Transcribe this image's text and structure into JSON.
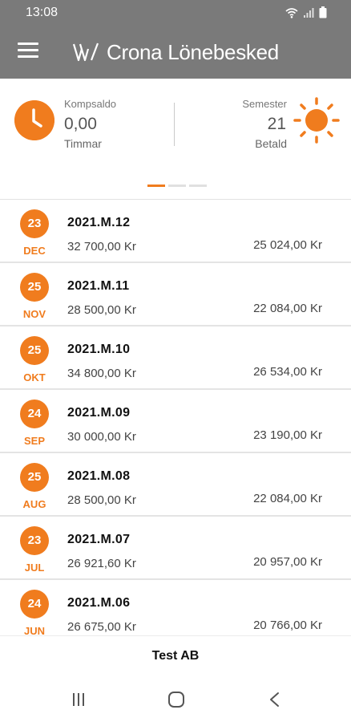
{
  "status_bar": {
    "time": "13:08",
    "icons": [
      "wifi-icon",
      "signal-icon",
      "battery-icon"
    ]
  },
  "app_bar": {
    "title": "Crona Lönebesked",
    "menu_icon": "hamburger-menu-icon",
    "logo_icon": "crona-logo-icon"
  },
  "colors": {
    "accent": "#f07c1e",
    "app_bar": "#7a7a7a"
  },
  "summary": {
    "komp": {
      "label": "Kompsaldo",
      "value": "0,00",
      "unit": "Timmar",
      "icon": "clock-icon"
    },
    "semester": {
      "label": "Semester",
      "value": "21",
      "unit": "Betald",
      "icon": "sun-icon"
    },
    "pager": {
      "pages": 3,
      "active": 1
    }
  },
  "payslips": [
    {
      "day": "23",
      "month": "DEC",
      "period": "2021.M.12",
      "gross": "32 700,00 Kr",
      "net": "25 024,00 Kr"
    },
    {
      "day": "25",
      "month": "NOV",
      "period": "2021.M.11",
      "gross": "28 500,00 Kr",
      "net": "22 084,00 Kr"
    },
    {
      "day": "25",
      "month": "OKT",
      "period": "2021.M.10",
      "gross": "34 800,00 Kr",
      "net": "26 534,00 Kr"
    },
    {
      "day": "24",
      "month": "SEP",
      "period": "2021.M.09",
      "gross": "30 000,00 Kr",
      "net": "23 190,00 Kr"
    },
    {
      "day": "25",
      "month": "AUG",
      "period": "2021.M.08",
      "gross": "28 500,00 Kr",
      "net": "22 084,00 Kr"
    },
    {
      "day": "23",
      "month": "JUL",
      "period": "2021.M.07",
      "gross": "26 921,60 Kr",
      "net": "20 957,00 Kr"
    },
    {
      "day": "24",
      "month": "JUN",
      "period": "2021.M.06",
      "gross": "26 675,00 Kr",
      "net": "20 766,00 Kr"
    }
  ],
  "footer": {
    "company": "Test AB"
  },
  "nav": {
    "recents_icon": "recents-icon",
    "home_icon": "home-icon",
    "back_icon": "back-icon"
  }
}
